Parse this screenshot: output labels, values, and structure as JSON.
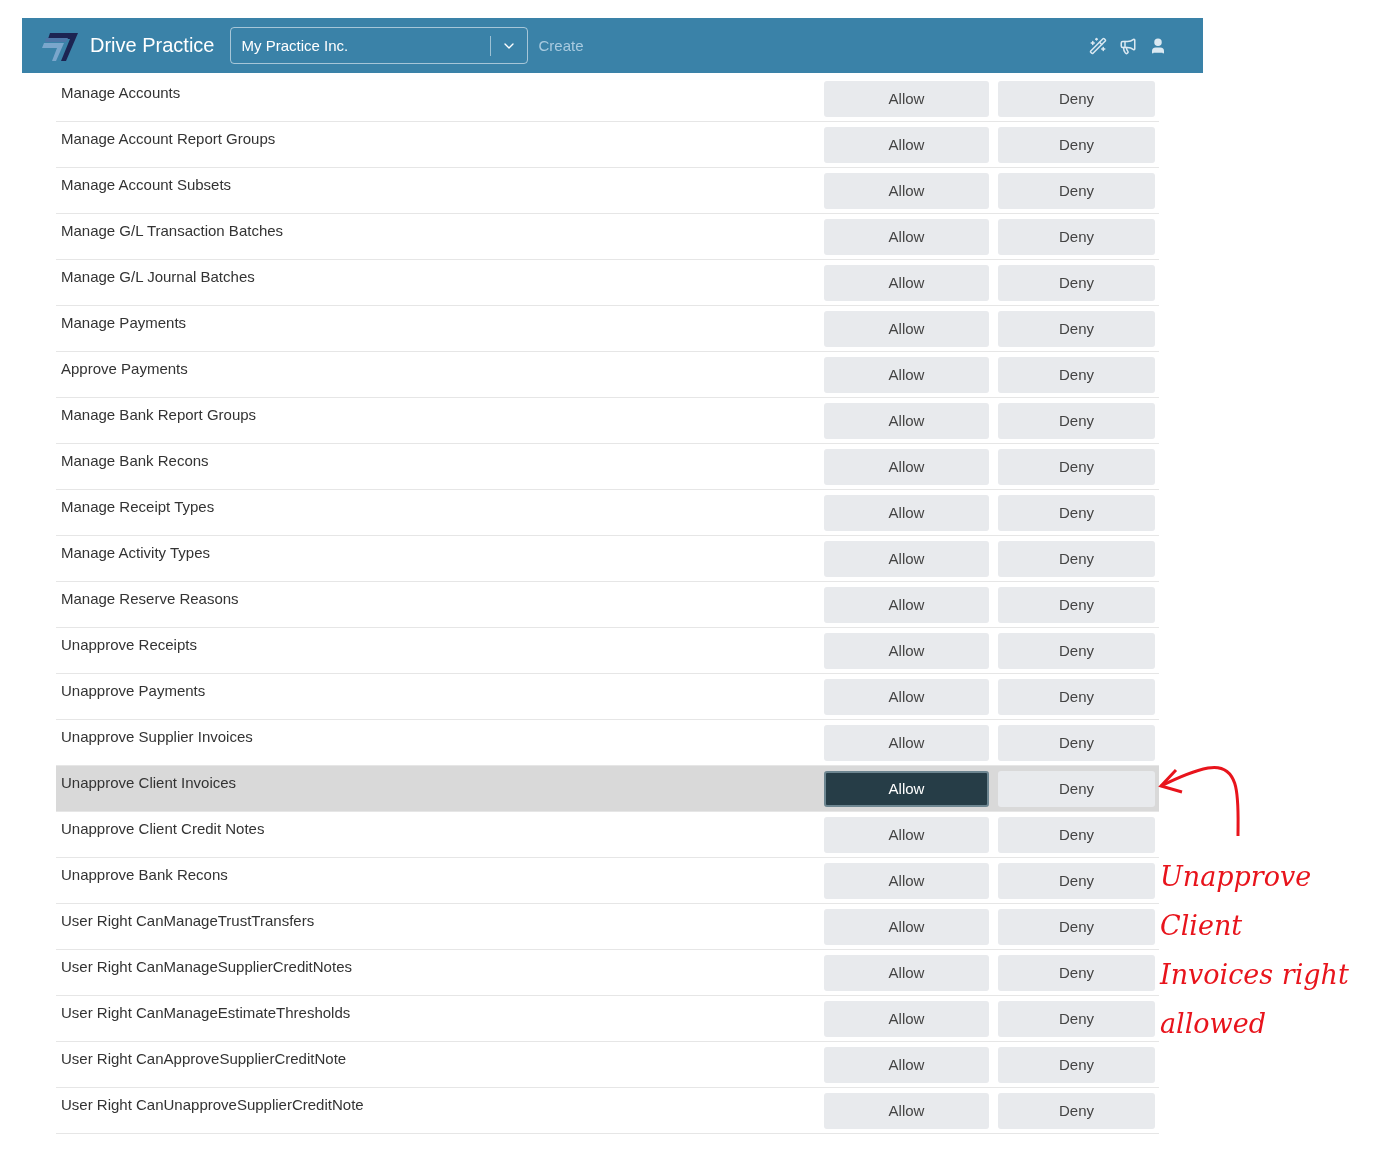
{
  "header": {
    "brand": "Drive Practice",
    "company_select": {
      "value": "My Practice Inc."
    },
    "create_link": "Create"
  },
  "rights": [
    {
      "label": "Manage Accounts",
      "highlighted": false,
      "buttons": [
        {
          "label": "Allow",
          "selected": false
        },
        {
          "label": "Deny",
          "selected": false
        }
      ]
    },
    {
      "label": "Manage Account Report Groups",
      "highlighted": false,
      "buttons": [
        {
          "label": "Allow",
          "selected": false
        },
        {
          "label": "Deny",
          "selected": false
        }
      ]
    },
    {
      "label": "Manage Account Subsets",
      "highlighted": false,
      "buttons": [
        {
          "label": "Allow",
          "selected": false
        },
        {
          "label": "Deny",
          "selected": false
        }
      ]
    },
    {
      "label": "Manage G/L Transaction Batches",
      "highlighted": false,
      "buttons": [
        {
          "label": "Allow",
          "selected": false
        },
        {
          "label": "Deny",
          "selected": false
        }
      ]
    },
    {
      "label": "Manage G/L Journal Batches",
      "highlighted": false,
      "buttons": [
        {
          "label": "Allow",
          "selected": false
        },
        {
          "label": "Deny",
          "selected": false
        }
      ]
    },
    {
      "label": "Manage Payments",
      "highlighted": false,
      "buttons": [
        {
          "label": "Allow",
          "selected": false
        },
        {
          "label": "Deny",
          "selected": false
        }
      ]
    },
    {
      "label": "Approve Payments",
      "highlighted": false,
      "buttons": [
        {
          "label": "Allow",
          "selected": false
        },
        {
          "label": "Deny",
          "selected": false
        }
      ]
    },
    {
      "label": "Manage Bank Report Groups",
      "highlighted": false,
      "buttons": [
        {
          "label": "Allow",
          "selected": false
        },
        {
          "label": "Deny",
          "selected": false
        }
      ]
    },
    {
      "label": "Manage Bank Recons",
      "highlighted": false,
      "buttons": [
        {
          "label": "Allow",
          "selected": false
        },
        {
          "label": "Deny",
          "selected": false
        }
      ]
    },
    {
      "label": "Manage Receipt Types",
      "highlighted": false,
      "buttons": [
        {
          "label": "Allow",
          "selected": false
        },
        {
          "label": "Deny",
          "selected": false
        }
      ]
    },
    {
      "label": "Manage Activity Types",
      "highlighted": false,
      "buttons": [
        {
          "label": "Allow",
          "selected": false
        },
        {
          "label": "Deny",
          "selected": false
        }
      ]
    },
    {
      "label": "Manage Reserve Reasons",
      "highlighted": false,
      "buttons": [
        {
          "label": "Allow",
          "selected": false
        },
        {
          "label": "Deny",
          "selected": false
        }
      ]
    },
    {
      "label": "Unapprove Receipts",
      "highlighted": false,
      "buttons": [
        {
          "label": "Allow",
          "selected": false
        },
        {
          "label": "Deny",
          "selected": false
        }
      ]
    },
    {
      "label": "Unapprove Payments",
      "highlighted": false,
      "buttons": [
        {
          "label": "Allow",
          "selected": false
        },
        {
          "label": "Deny",
          "selected": false
        }
      ]
    },
    {
      "label": "Unapprove Supplier Invoices",
      "highlighted": false,
      "buttons": [
        {
          "label": "Allow",
          "selected": false
        },
        {
          "label": "Deny",
          "selected": false
        }
      ]
    },
    {
      "label": "Unapprove Client Invoices",
      "highlighted": true,
      "buttons": [
        {
          "label": "Allow",
          "selected": true
        },
        {
          "label": "Deny",
          "selected": false
        }
      ]
    },
    {
      "label": "Unapprove Client Credit Notes",
      "highlighted": false,
      "buttons": [
        {
          "label": "Allow",
          "selected": false
        },
        {
          "label": "Deny",
          "selected": false
        }
      ]
    },
    {
      "label": "Unapprove Bank Recons",
      "highlighted": false,
      "buttons": [
        {
          "label": "Allow",
          "selected": false
        },
        {
          "label": "Deny",
          "selected": false
        }
      ]
    },
    {
      "label": "User Right CanManageTrustTransfers",
      "highlighted": false,
      "buttons": [
        {
          "label": "Allow",
          "selected": false
        },
        {
          "label": "Deny",
          "selected": false
        }
      ]
    },
    {
      "label": "User Right CanManageSupplierCreditNotes",
      "highlighted": false,
      "buttons": [
        {
          "label": "Allow",
          "selected": false
        },
        {
          "label": "Deny",
          "selected": false
        }
      ]
    },
    {
      "label": "User Right CanManageEstimateThresholds",
      "highlighted": false,
      "buttons": [
        {
          "label": "Allow",
          "selected": false
        },
        {
          "label": "Deny",
          "selected": false
        }
      ]
    },
    {
      "label": "User Right CanApproveSupplierCreditNote",
      "highlighted": false,
      "buttons": [
        {
          "label": "Allow",
          "selected": false
        },
        {
          "label": "Deny",
          "selected": false
        }
      ]
    },
    {
      "label": "User Right CanUnapproveSupplierCreditNote",
      "highlighted": false,
      "buttons": [
        {
          "label": "Allow",
          "selected": false
        },
        {
          "label": "Deny",
          "selected": false
        }
      ]
    }
  ],
  "annotation": {
    "lines": [
      "Unapprove",
      "Client",
      "Invoices right",
      "allowed"
    ]
  }
}
